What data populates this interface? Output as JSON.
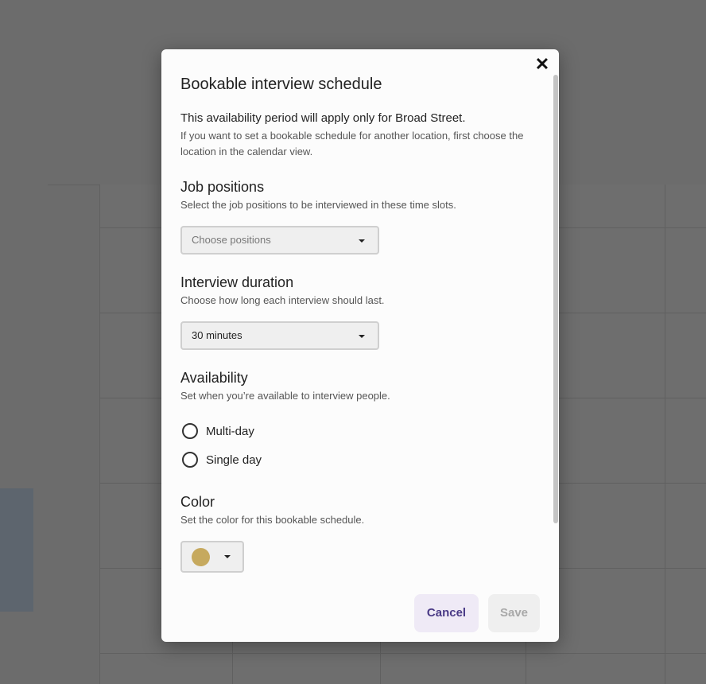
{
  "modal": {
    "title": "Bookable interview schedule",
    "lead": "This availability period will apply only for Broad Street.",
    "note": "If you want to set a bookable schedule for another location, first choose the location in the calendar view.",
    "close_icon": "✕"
  },
  "job_positions": {
    "title": "Job positions",
    "description": "Select the job positions to be interviewed in these time slots.",
    "placeholder": "Choose positions"
  },
  "interview_duration": {
    "title": "Interview duration",
    "description": "Choose how long each interview should last.",
    "value": "30 minutes"
  },
  "availability": {
    "title": "Availability",
    "description": "Set when you’re available to interview people.",
    "options": [
      "Multi-day",
      "Single day"
    ]
  },
  "color": {
    "title": "Color",
    "description": "Set the color for this bookable schedule.",
    "selected": "#c6a95e"
  },
  "actions": {
    "cancel": "Cancel",
    "save": "Save"
  },
  "colors": {
    "cancel_bg": "#efeaf6",
    "cancel_text": "#4a3a86",
    "save_text": "#a8a8a8"
  }
}
